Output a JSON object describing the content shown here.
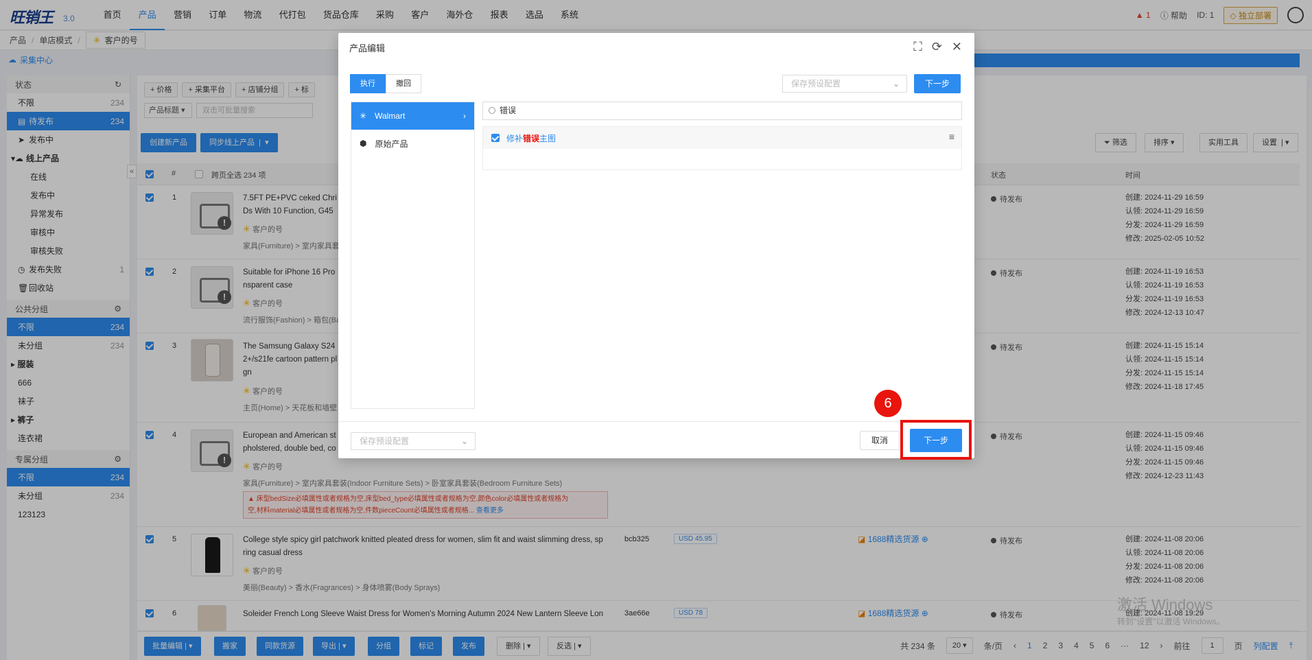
{
  "logo": {
    "text": "旺销王",
    "version": "3.0"
  },
  "nav": [
    "首页",
    "产品",
    "营销",
    "订单",
    "物流",
    "代打包",
    "货品仓库",
    "采购",
    "客户",
    "海外仓",
    "报表",
    "选品",
    "系统"
  ],
  "topright": {
    "alert": "1",
    "help": "帮助",
    "id": "ID: 1",
    "deploy": "独立部署"
  },
  "breadcrumb": {
    "a": "产品",
    "b": "单店模式",
    "store": "客户的号"
  },
  "collect": "采集中心",
  "sidebar": {
    "status_head": "状态",
    "status": [
      {
        "label": "不限",
        "count": "234"
      },
      {
        "label": "待发布",
        "count": "234"
      },
      {
        "label": "发布中",
        "count": ""
      },
      {
        "label": "线上产品",
        "count": ""
      },
      {
        "label": "在线",
        "count": ""
      },
      {
        "label": "发布中",
        "count": ""
      },
      {
        "label": "异常发布",
        "count": ""
      },
      {
        "label": "审核中",
        "count": ""
      },
      {
        "label": "审核失败",
        "count": ""
      },
      {
        "label": "发布失败",
        "count": "1"
      },
      {
        "label": "回收站",
        "count": ""
      }
    ],
    "public_head": "公共分组",
    "public": [
      {
        "label": "不限",
        "count": "234"
      },
      {
        "label": "未分组",
        "count": "234"
      },
      {
        "label": "服装",
        "count": ""
      },
      {
        "label": "666",
        "count": ""
      },
      {
        "label": "袜子",
        "count": ""
      },
      {
        "label": "裤子",
        "count": ""
      },
      {
        "label": "连衣裙",
        "count": ""
      }
    ],
    "private_head": "专属分组",
    "private": [
      {
        "label": "不限",
        "count": "234"
      },
      {
        "label": "未分组",
        "count": "234"
      },
      {
        "label": "123123",
        "count": ""
      }
    ]
  },
  "toolbar": {
    "filters": [
      "+ 价格",
      "+ 采集平台",
      "+ 店铺分组",
      "+ 标"
    ],
    "title_select": "产品标题",
    "search_placeholder": "双击可批量搜索",
    "create": "创建新产品",
    "sync": "同步线上产品",
    "right": [
      "筛选",
      "排序",
      "实用工具",
      "设置"
    ]
  },
  "table": {
    "headers": {
      "num": "#",
      "crosspage": "跨页全选 234 项",
      "status": "状态",
      "time": "时间"
    },
    "rows": [
      {
        "n": "1",
        "title": "7.5FT PE+PVC ceked Chri",
        "title2": "Ds With 10 Function, G45",
        "store": "客户的号",
        "cat": "家具(Furniture) > 室内家具套",
        "status": "待发布",
        "t": [
          "创建: 2024-11-29 16:59",
          "认领: 2024-11-29 16:59",
          "分发: 2024-11-29 16:59",
          "修改: 2025-02-05 10:52"
        ]
      },
      {
        "n": "2",
        "title": "Suitable for iPhone 16 Pro",
        "title2": "nsparent case",
        "store": "客户的号",
        "cat": "流行服饰(Fashion) > 箱包(Ba",
        "status": "待发布",
        "t": [
          "创建: 2024-11-19 16:53",
          "认领: 2024-11-19 16:53",
          "分发: 2024-11-19 16:53",
          "修改: 2024-12-13 10:47"
        ]
      },
      {
        "n": "3",
        "title": "The Samsung Galaxy S24",
        "title2": "2+/s21fe cartoon pattern pl",
        "title3": "gn",
        "store": "客户的号",
        "cat": "主页(Home) > 天花板和墙壁",
        "status": "待发布",
        "t": [
          "创建: 2024-11-15 15:14",
          "认领: 2024-11-15 15:14",
          "分发: 2024-11-15 15:14",
          "修改: 2024-11-18 17:45"
        ]
      },
      {
        "n": "4",
        "title": "European and American st",
        "title2": "pholstered, double bed, co",
        "store": "客户的号",
        "cat": "家具(Furniture) > 室内家具套装(Indoor Furniture Sets) > 卧室家具套装(Bedroom Furniture Sets)",
        "status": "待发布",
        "err1": "床型bedSize必填属性或者规格为空,床型bed_type必填属性或者规格为空,颜色color必填属性或者规格为",
        "err2": "空,材料material必填属性或者规格为空,件数pieceCount必填属性或者规格...",
        "more": "查看更多",
        "t": [
          "创建: 2024-11-15 09:46",
          "认领: 2024-11-15 09:46",
          "分发: 2024-11-15 09:46",
          "修改: 2024-12-23 11:43"
        ]
      },
      {
        "n": "5",
        "title": "College style spicy girl patchwork knitted pleated dress for women, slim fit and waist slimming dress, sp",
        "title2": "ring casual dress",
        "store": "客户的号",
        "cat": "美丽(Beauty) > 香水(Fragrances) > 身体喷雾(Body Sprays)",
        "sku": "bcb325",
        "price": "USD  45.95",
        "src": "1688精选货源",
        "status": "待发布",
        "t": [
          "创建: 2024-11-08 20:06",
          "认领: 2024-11-08 20:06",
          "分发: 2024-11-08 20:06",
          "修改: 2024-11-08 20:06"
        ]
      },
      {
        "n": "6",
        "title": "Soleider French Long Sleeve Waist Dress for Women's Morning Autumn 2024 New Lantern Sleeve Lon",
        "sku": "3ae66e",
        "price": "USD  78",
        "src": "1688精选货源",
        "status": "待发布",
        "t": [
          "创建: 2024-11-08 19:29"
        ]
      }
    ]
  },
  "bottom": {
    "buttons": [
      "批量编辑",
      "搬家",
      "同款货源",
      "导出",
      "分组",
      "标记",
      "发布"
    ],
    "delete": "删除",
    "invert": "反选",
    "total": "共 234 条",
    "pagesize": "20",
    "per": "条/页",
    "pages": [
      "1",
      "2",
      "3",
      "4",
      "5",
      "6",
      "···",
      "12"
    ],
    "goto": "前往",
    "goto_val": "1",
    "page_unit": "页",
    "colconf": "列配置"
  },
  "modal": {
    "title": "产品编辑",
    "seg_exec": "执行",
    "seg_undo": "撤回",
    "preset": "保存预设配置",
    "next": "下一步",
    "left": [
      "Walmart",
      "原始产品"
    ],
    "search_value": "错误",
    "item_pre": "修补",
    "item_hl": "错误",
    "item_post": "主图",
    "cancel": "取消"
  },
  "annotation": "6",
  "watermark": {
    "line1": "激活 Windows",
    "line2": "转到\"设置\"以激活 Windows。"
  },
  "colors": {
    "primary": "#2d8cf0",
    "danger": "#e8140d"
  }
}
